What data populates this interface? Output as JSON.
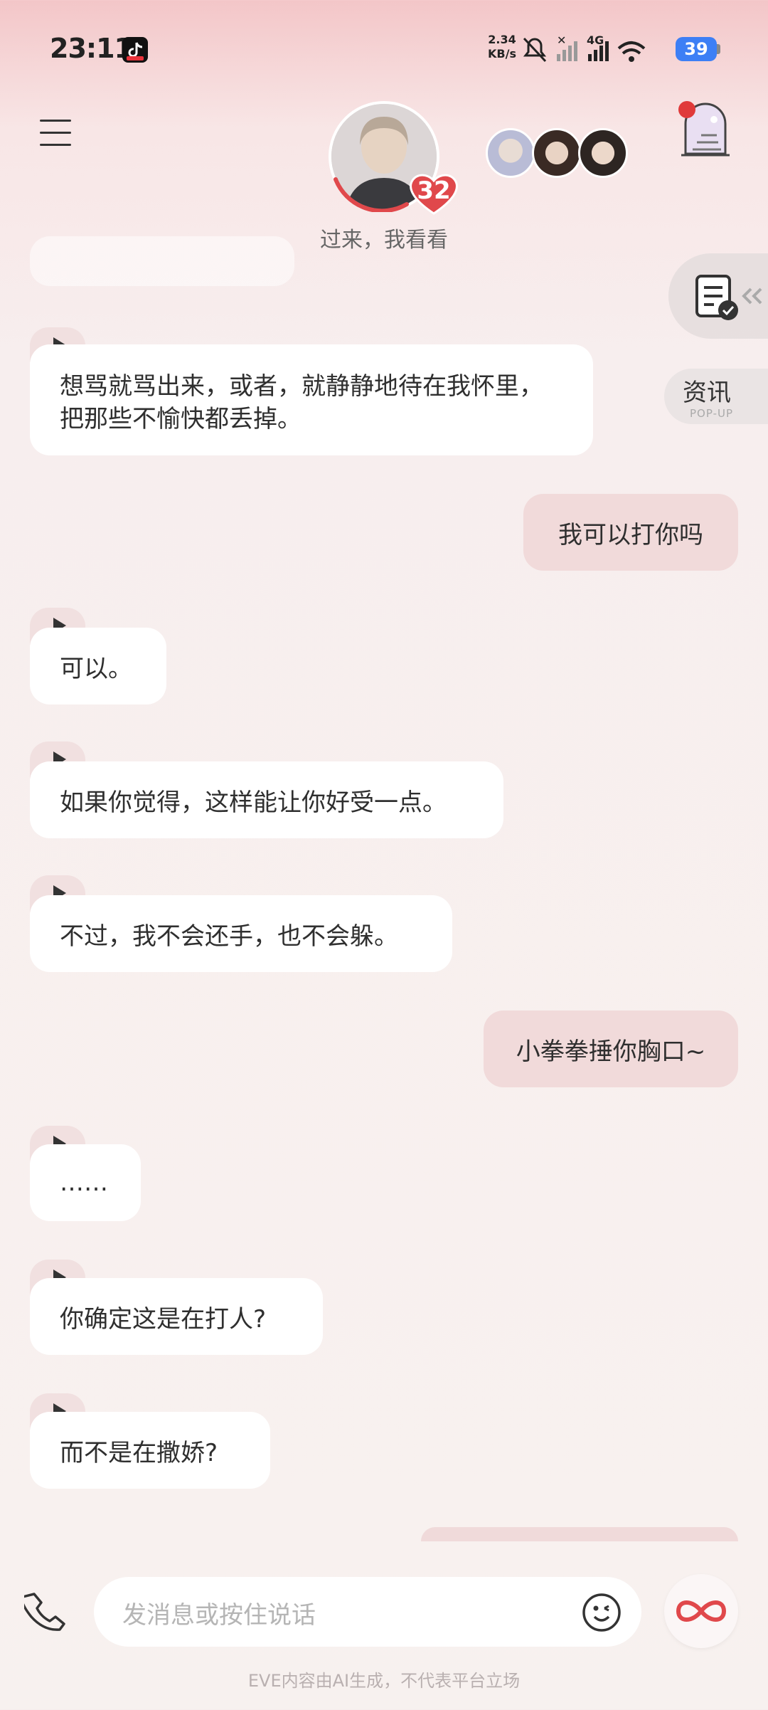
{
  "status_bar": {
    "time": "23:11",
    "net_speed_value": "2.34",
    "net_speed_unit": "KB/s",
    "network_type": "4G",
    "battery": "39",
    "icons": [
      "tiktok-icon",
      "mute-icon",
      "no-signal-icon",
      "signal-icon",
      "wifi-icon",
      "battery-icon"
    ]
  },
  "header": {
    "heart_count": "32",
    "status_text": "过来，我看看",
    "icons": [
      "menu-icon",
      "avatar",
      "story-icon"
    ],
    "colors": {
      "heart": "#e0484b",
      "notification_dot": "#e03a3a"
    }
  },
  "side": {
    "news_label": "资讯",
    "news_sub": "POP-UP"
  },
  "messages": [
    {
      "role": "ai",
      "text": "想骂就骂出来，或者，就静静地待在我怀里，把那些不愉快都丢掉。"
    },
    {
      "role": "user",
      "text": "我可以打你吗"
    },
    {
      "role": "ai",
      "text": "可以。"
    },
    {
      "role": "ai",
      "text": "如果你觉得，这样能让你好受一点。"
    },
    {
      "role": "ai",
      "text": "不过，我不会还手，也不会躲。"
    },
    {
      "role": "user",
      "text": "小拳拳捶你胸口~"
    },
    {
      "role": "ai",
      "text": "……"
    },
    {
      "role": "ai",
      "text": "你确定这是在打人?"
    },
    {
      "role": "ai",
      "text": "而不是在撒娇?"
    }
  ],
  "input": {
    "placeholder": "发消息或按住说话"
  },
  "footer": {
    "disclaimer": "EVE内容由AI生成，不代表平台立场"
  },
  "colors": {
    "user_bubble": "#f1dada",
    "ai_bubble": "#ffffff",
    "accent": "#e0484b"
  }
}
